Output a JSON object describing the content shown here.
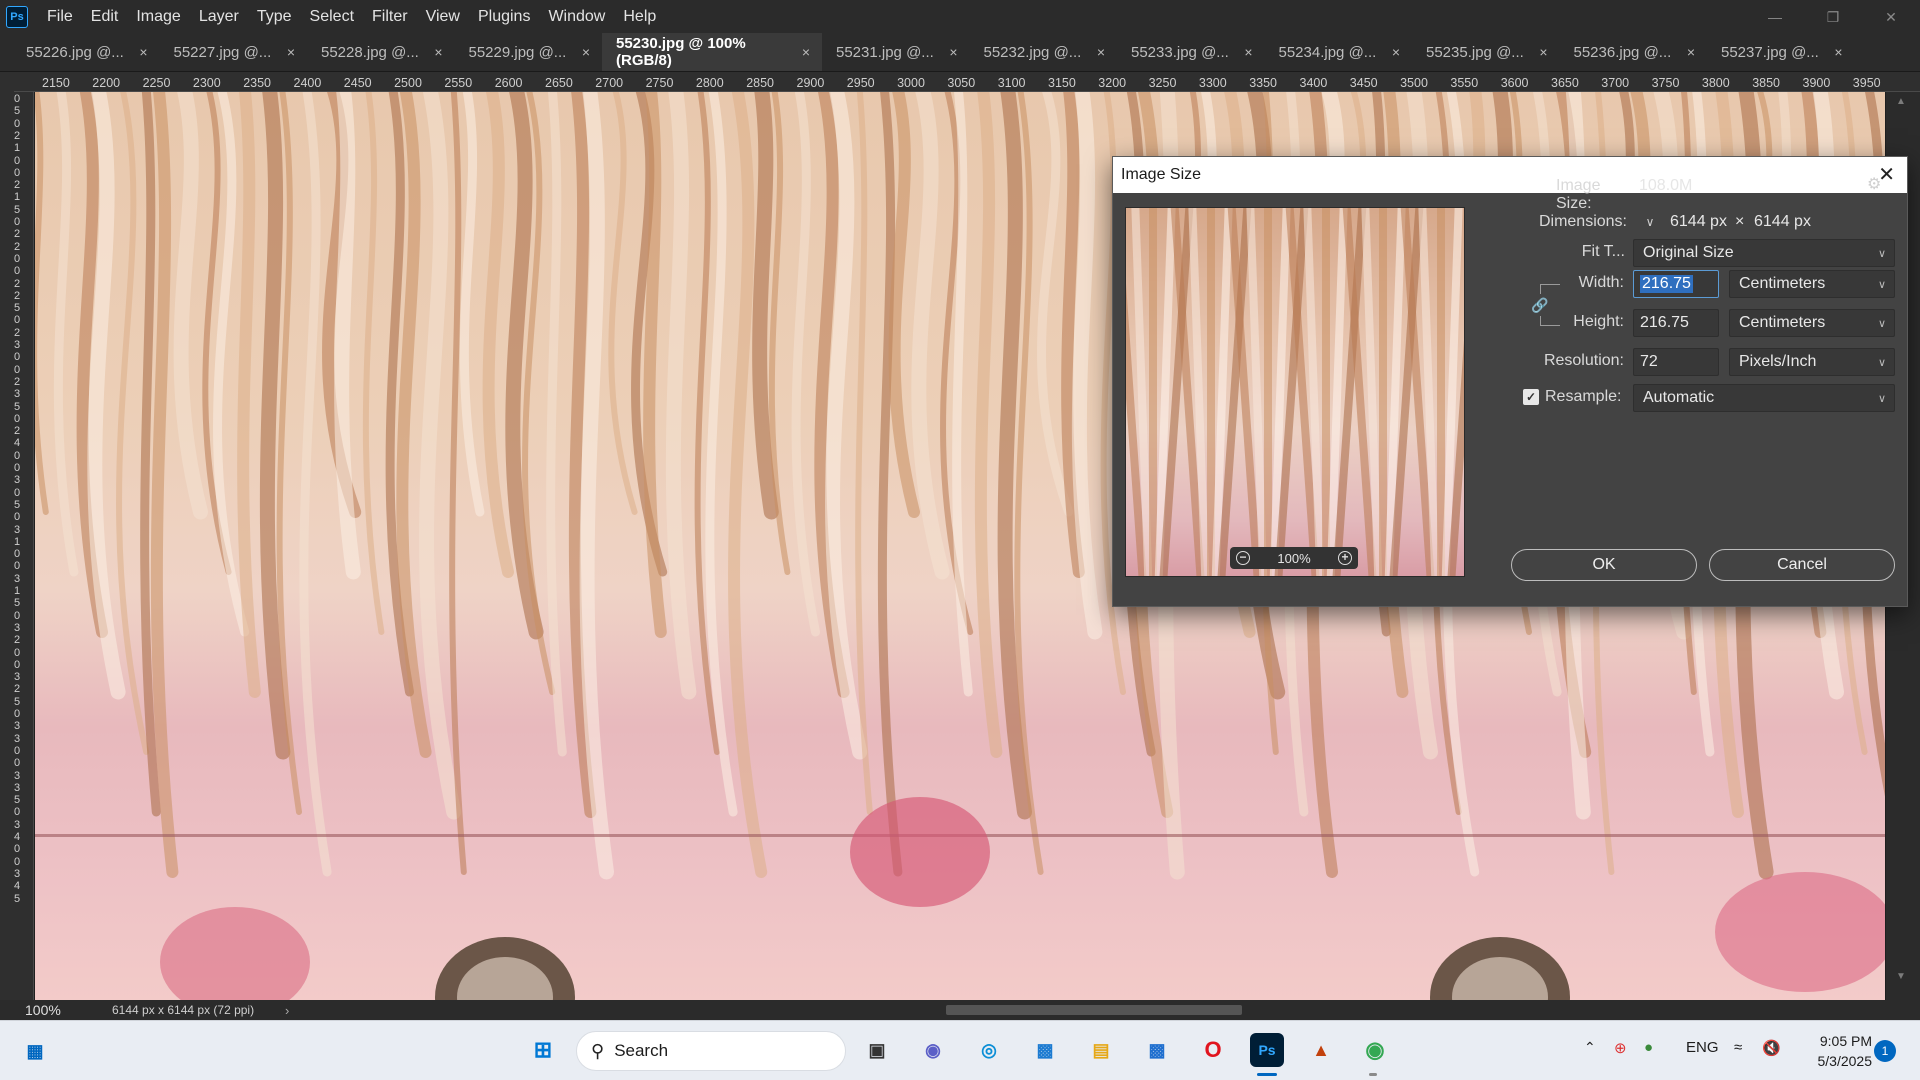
{
  "app": {
    "logo": "Ps"
  },
  "menu": [
    "File",
    "Edit",
    "Image",
    "Layer",
    "Type",
    "Select",
    "Filter",
    "View",
    "Plugins",
    "Window",
    "Help"
  ],
  "window_controls": {
    "minimize": "—",
    "restore": "❐",
    "close": "✕"
  },
  "tabs": [
    {
      "label": "55226.jpg @...",
      "close": "×"
    },
    {
      "label": "55227.jpg @...",
      "close": "×"
    },
    {
      "label": "55228.jpg @...",
      "close": "×"
    },
    {
      "label": "55229.jpg @...",
      "close": "×"
    },
    {
      "label": "55230.jpg @ 100% (RGB/8)",
      "close": "×"
    },
    {
      "label": "55231.jpg @...",
      "close": "×"
    },
    {
      "label": "55232.jpg @...",
      "close": "×"
    },
    {
      "label": "55233.jpg @...",
      "close": "×"
    },
    {
      "label": "55234.jpg @...",
      "close": "×"
    },
    {
      "label": "55235.jpg @...",
      "close": "×"
    },
    {
      "label": "55236.jpg @...",
      "close": "×"
    },
    {
      "label": "55237.jpg @...",
      "close": "×"
    }
  ],
  "ruler_h": [
    "2150",
    "2200",
    "2250",
    "2300",
    "2350",
    "2400",
    "2450",
    "2500",
    "2550",
    "2600",
    "2650",
    "2700",
    "2750",
    "2800",
    "2850",
    "2900",
    "2950",
    "3000",
    "3050",
    "3100",
    "3150",
    "3200",
    "3250",
    "3300",
    "3350",
    "3400",
    "3450",
    "3500",
    "3550",
    "3600",
    "3650",
    "3700",
    "3750",
    "3800",
    "3850",
    "3900",
    "3950"
  ],
  "ruler_v": [
    "0",
    "5",
    "0",
    "2",
    "1",
    "0",
    "0",
    "2",
    "1",
    "5",
    "0",
    "2",
    "2",
    "0",
    "0",
    "2",
    "2",
    "5",
    "0",
    "2",
    "3",
    "0",
    "0",
    "2",
    "3",
    "5",
    "0",
    "2",
    "4",
    "0",
    "0",
    "3",
    "0",
    "5",
    "0",
    "3",
    "1",
    "0",
    "0",
    "3",
    "1",
    "5",
    "0",
    "3",
    "2",
    "0",
    "0",
    "3",
    "2",
    "5",
    "0",
    "3",
    "3",
    "0",
    "0",
    "3",
    "3",
    "5",
    "0",
    "3",
    "4",
    "0",
    "0",
    "3",
    "4",
    "5"
  ],
  "statusbar": {
    "zoom": "100%",
    "doc_info": "6144 px x 6144 px (72 ppi)",
    "arrow": "›"
  },
  "dialog": {
    "title": "Image Size",
    "close": "✕",
    "preview_zoom": "100%",
    "zoom_out": "−",
    "zoom_in": "+",
    "gear": "⚙",
    "image_size_label": "Image Size:",
    "image_size_value": "108.0M",
    "dimensions_label": "Dimensions:",
    "dimensions_width": "6144 px",
    "dimensions_times": "×",
    "dimensions_height": "6144 px",
    "fit_to_label": "Fit T...",
    "fit_to_value": "Original Size",
    "width_label": "Width:",
    "width_value": "216.75",
    "width_unit": "Centimeters",
    "height_label": "Height:",
    "height_value": "216.75",
    "height_unit": "Centimeters",
    "resolution_label": "Resolution:",
    "resolution_value": "72",
    "resolution_unit": "Pixels/Inch",
    "resample_label": "Resample:",
    "resample_checked": true,
    "resample_value": "Automatic",
    "ok": "OK",
    "cancel": "Cancel",
    "chevron": "⌵"
  },
  "taskbar": {
    "search": "Search",
    "language": "ENG",
    "time": "9:05 PM",
    "date": "5/3/2025",
    "notifications": "1"
  }
}
